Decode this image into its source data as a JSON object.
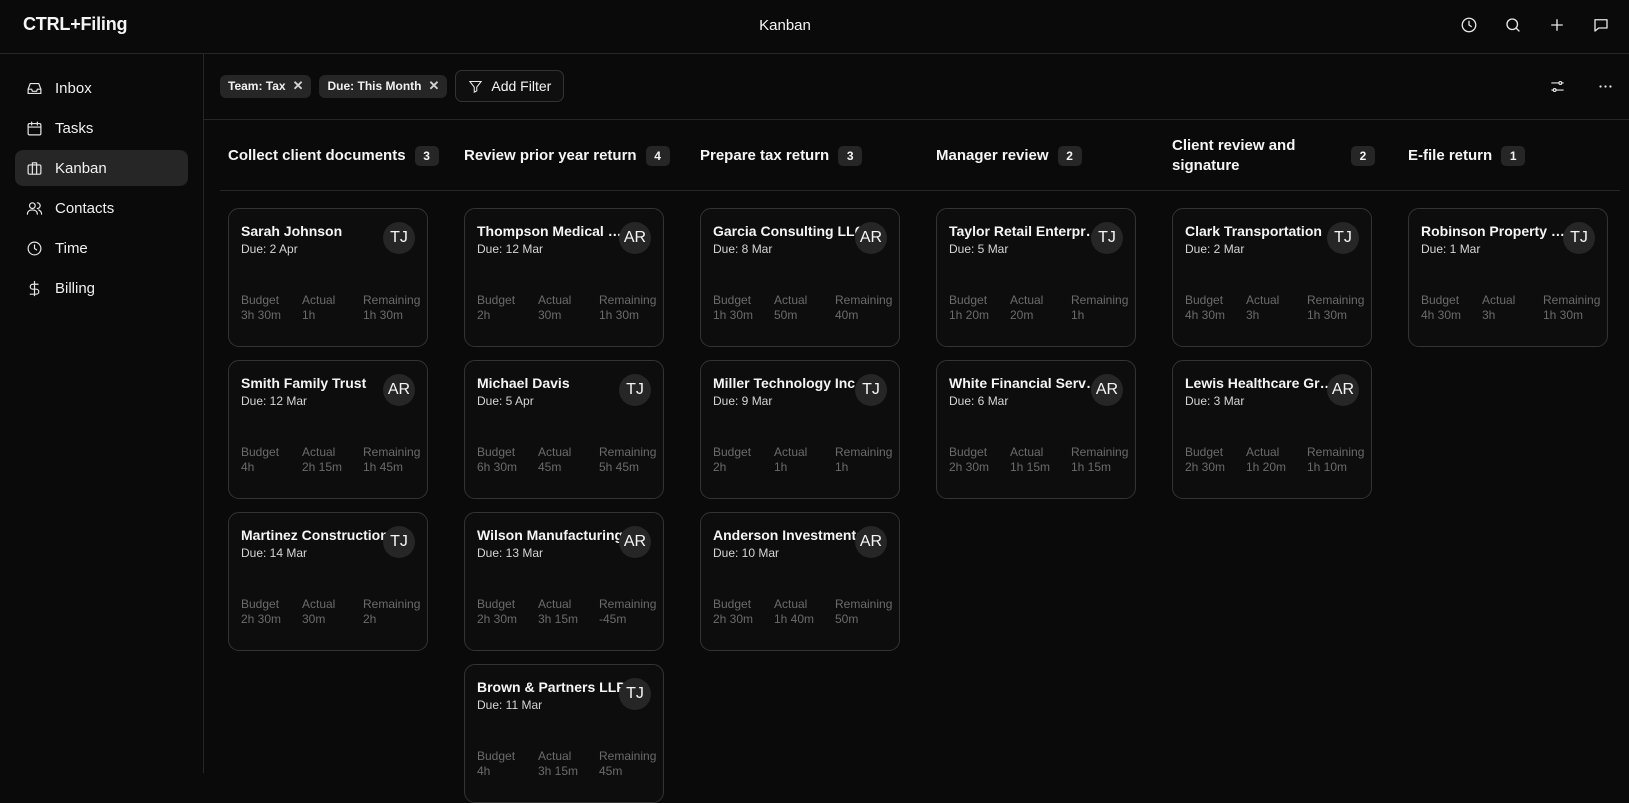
{
  "app": {
    "logo": "CTRL+Filing",
    "title": "Kanban"
  },
  "topbar_icons": [
    "clock-icon",
    "search-icon",
    "plus-icon",
    "chat-icon"
  ],
  "sidebar": {
    "items": [
      {
        "label": "Inbox",
        "icon": "inbox-icon"
      },
      {
        "label": "Tasks",
        "icon": "calendar-icon"
      },
      {
        "label": "Kanban",
        "icon": "kanban-icon",
        "active": true
      },
      {
        "label": "Contacts",
        "icon": "users-icon"
      },
      {
        "label": "Time",
        "icon": "clock-icon"
      },
      {
        "label": "Billing",
        "icon": "dollar-icon"
      }
    ]
  },
  "filters": {
    "chips": [
      "Team: Tax",
      "Due: This Month"
    ],
    "add_label": "Add Filter"
  },
  "metric_labels": {
    "budget": "Budget",
    "actual": "Actual",
    "remaining": "Remaining"
  },
  "columns": [
    {
      "title": "Collect client documents",
      "count": "3",
      "cards": [
        {
          "name": "Sarah Johnson",
          "due": "Due: 2 Apr",
          "assignee": "TJ",
          "budget": "3h 30m",
          "actual": "1h",
          "remaining": "1h 30m"
        },
        {
          "name": "Smith Family Trust",
          "due": "Due: 12 Mar",
          "assignee": "AR",
          "budget": "4h",
          "actual": "2h 15m",
          "remaining": "1h 45m"
        },
        {
          "name": "Martinez Construction",
          "due": "Due: 14 Mar",
          "assignee": "TJ",
          "budget": "2h 30m",
          "actual": "30m",
          "remaining": "2h"
        }
      ]
    },
    {
      "title": "Review prior year return",
      "count": "4",
      "cards": [
        {
          "name": "Thompson Medical Group",
          "due": "Due: 12 Mar",
          "assignee": "AR",
          "budget": "2h",
          "actual": "30m",
          "remaining": "1h 30m"
        },
        {
          "name": "Michael Davis",
          "due": "Due: 5 Apr",
          "assignee": "TJ",
          "budget": "6h 30m",
          "actual": "45m",
          "remaining": "5h 45m"
        },
        {
          "name": "Wilson Manufacturing",
          "due": "Due: 13 Mar",
          "assignee": "AR",
          "budget": "2h 30m",
          "actual": "3h 15m",
          "remaining": "-45m"
        },
        {
          "name": "Brown & Partners LLP",
          "due": "Due: 11 Mar",
          "assignee": "TJ",
          "budget": "4h",
          "actual": "3h 15m",
          "remaining": "45m"
        }
      ]
    },
    {
      "title": "Prepare tax return",
      "count": "3",
      "cards": [
        {
          "name": "Garcia Consulting LLC",
          "due": "Due: 8 Mar",
          "assignee": "AR",
          "budget": "1h 30m",
          "actual": "50m",
          "remaining": "40m"
        },
        {
          "name": "Miller Technology Inc",
          "due": "Due: 9 Mar",
          "assignee": "TJ",
          "budget": "2h",
          "actual": "1h",
          "remaining": "1h"
        },
        {
          "name": "Anderson Investments",
          "due": "Due: 10 Mar",
          "assignee": "AR",
          "budget": "2h 30m",
          "actual": "1h 40m",
          "remaining": "50m"
        }
      ]
    },
    {
      "title": "Manager review",
      "count": "2",
      "cards": [
        {
          "name": "Taylor Retail Enterprises",
          "due": "Due: 5 Mar",
          "assignee": "TJ",
          "budget": "1h 20m",
          "actual": "20m",
          "remaining": "1h"
        },
        {
          "name": "White Financial Services",
          "due": "Due: 6 Mar",
          "assignee": "AR",
          "budget": "2h 30m",
          "actual": "1h 15m",
          "remaining": "1h 15m"
        }
      ]
    },
    {
      "title": "Client review and signature",
      "count": "2",
      "cards": [
        {
          "name": "Clark Transportation",
          "due": "Due: 2 Mar",
          "assignee": "TJ",
          "budget": "4h 30m",
          "actual": "3h",
          "remaining": "1h 30m"
        },
        {
          "name": "Lewis Healthcare Group",
          "due": "Due: 3 Mar",
          "assignee": "AR",
          "budget": "2h 30m",
          "actual": "1h 20m",
          "remaining": "1h 10m"
        }
      ]
    },
    {
      "title": "E-file return",
      "count": "1",
      "cards": [
        {
          "name": "Robinson Property Group",
          "due": "Due: 1 Mar",
          "assignee": "TJ",
          "budget": "4h 30m",
          "actual": "3h",
          "remaining": "1h 30m"
        }
      ]
    }
  ]
}
